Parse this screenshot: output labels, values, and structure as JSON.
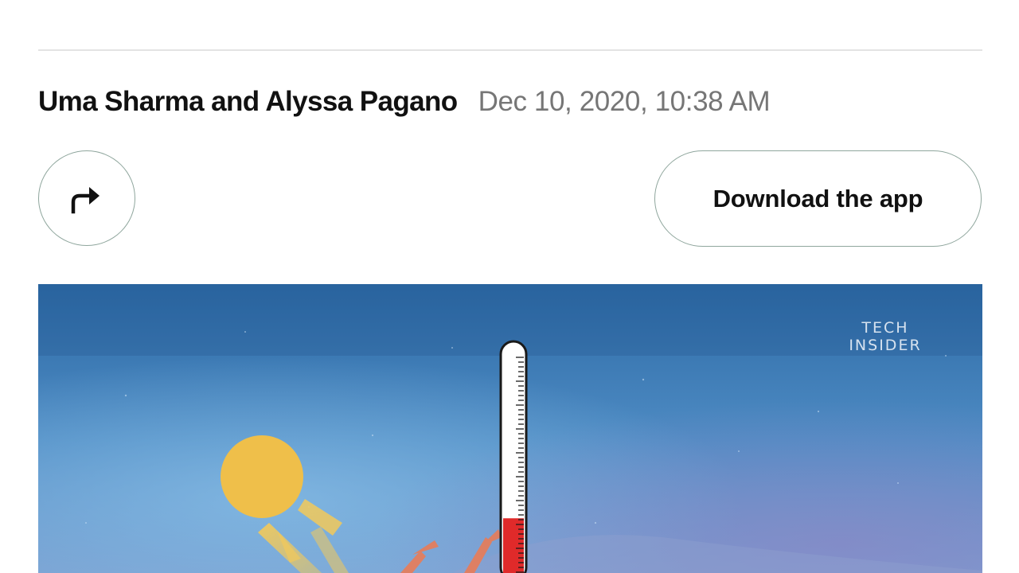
{
  "article": {
    "authors": "Uma Sharma and Alyssa Pagano",
    "timestamp": "Dec 10, 2020, 10:38 AM"
  },
  "actions": {
    "share_icon": "share-arrow-icon",
    "download_label": "Download the app"
  },
  "media": {
    "watermark_line1": "TECH",
    "watermark_line2": "INSIDER",
    "thermometer_level": 0.25
  },
  "colors": {
    "border": "#8fa69d",
    "text_primary": "#111111",
    "text_secondary": "#767676",
    "sun": "#efbf4a",
    "thermometer_fill": "#e02a2a"
  }
}
